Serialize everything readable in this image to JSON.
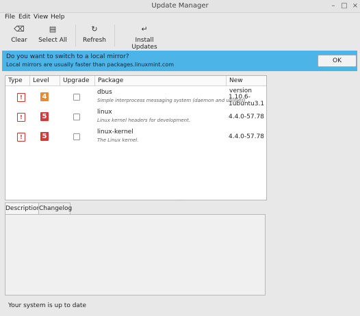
{
  "window": {
    "title": "Update Manager",
    "controls": [
      "–",
      "□",
      "×"
    ]
  },
  "menu": [
    {
      "label": "File"
    },
    {
      "label": "Edit"
    },
    {
      "label": "View"
    },
    {
      "label": "Help"
    }
  ],
  "toolbar": {
    "clear": {
      "label": "Clear",
      "icon": "backspace-icon",
      "glyph": "⌫"
    },
    "select_all": {
      "label": "Select All",
      "icon": "document-icon",
      "glyph": "▤"
    },
    "refresh": {
      "label": "Refresh",
      "icon": "refresh-icon",
      "glyph": "↻"
    },
    "install": {
      "label": "Install Updates",
      "icon": "install-icon",
      "glyph": "↵"
    }
  },
  "infobar": {
    "title": "Do you want to switch to a local mirror?",
    "subtitle": "Local mirrors are usually faster than packages.linuxmint.com",
    "ok_label": "OK",
    "color": "#4db4e7"
  },
  "table": {
    "headers": [
      "Type",
      "Level",
      "Upgrade",
      "Package",
      "New version"
    ],
    "rows": [
      {
        "type_icon": "!",
        "level": "4",
        "level_color": "#e88a2e",
        "upgrade": false,
        "name": "dbus",
        "description": "Simple interprocess messaging system (daemon and utilities)",
        "version": "1.10.6-1ubuntu3.1"
      },
      {
        "type_icon": "!",
        "level": "5",
        "level_color": "#d33b3b",
        "upgrade": false,
        "name": "linux",
        "description": "Linux kernel headers for development.",
        "version": "4.4.0-57.78"
      },
      {
        "type_icon": "!",
        "level": "5",
        "level_color": "#d33b3b",
        "upgrade": false,
        "name": "linux-kernel",
        "description": "The Linux kernel.",
        "version": "4.4.0-57.78"
      }
    ]
  },
  "tabs": [
    {
      "label": "Description",
      "active": true
    },
    {
      "label": "Changelog",
      "active": false
    }
  ],
  "status": {
    "text": "Your system is up to date"
  }
}
